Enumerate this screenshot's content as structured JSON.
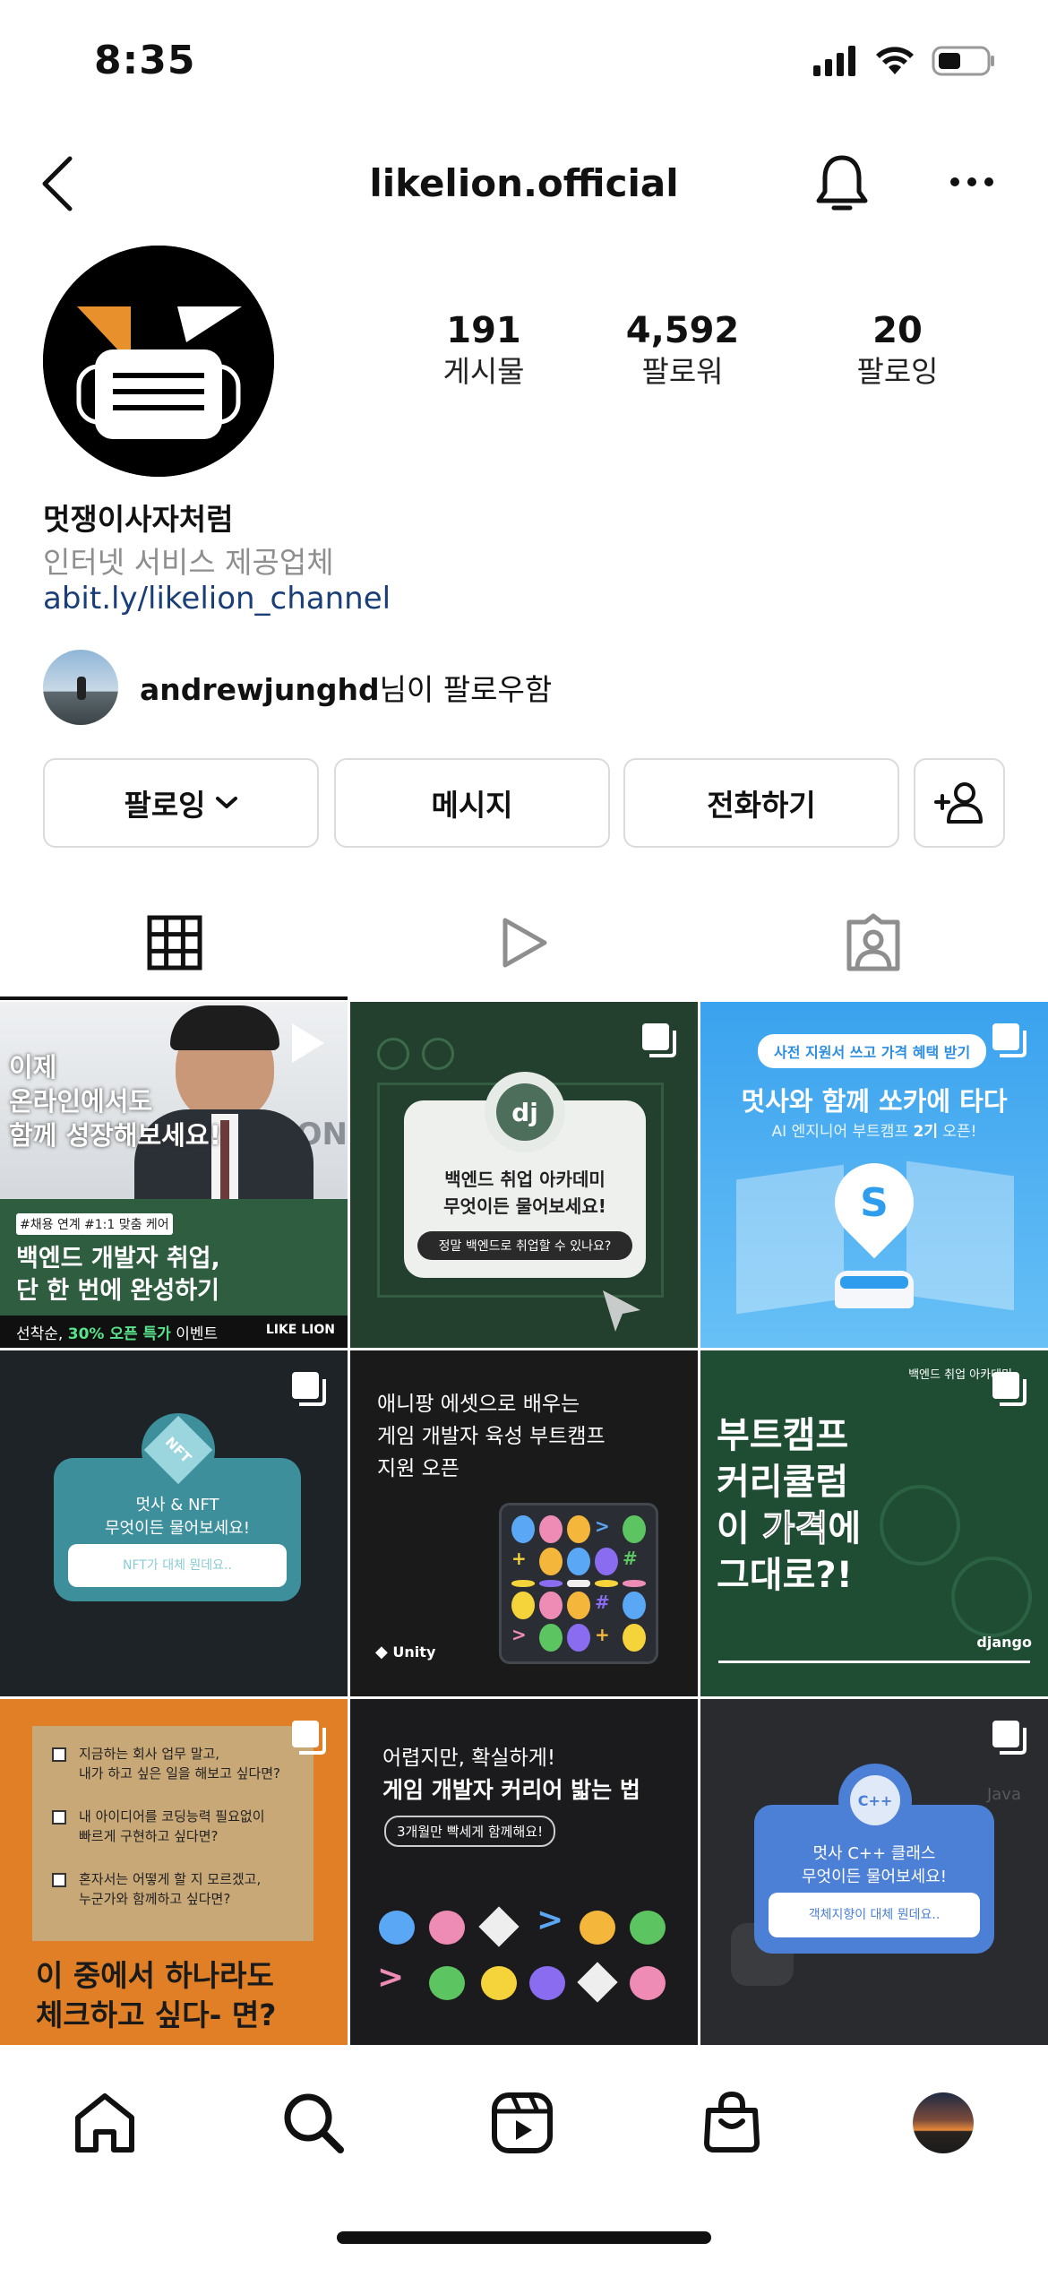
{
  "status_bar": {
    "time": "8:35"
  },
  "header": {
    "username": "likelion.official"
  },
  "profile": {
    "display_name": "멋쟁이사자처럼",
    "category": "인터넷 서비스 제공업체",
    "link": "abit.ly/likelion_channel",
    "stats": [
      {
        "number": "191",
        "label": "게시물"
      },
      {
        "number": "4,592",
        "label": "팔로워"
      },
      {
        "number": "20",
        "label": "팔로잉"
      }
    ],
    "followed_by": {
      "user": "andrewjunghd",
      "suffix": "님이 팔로우함"
    }
  },
  "actions": {
    "following_label": "팔로잉",
    "message_label": "메시지",
    "call_label": "전화하기"
  },
  "posts": {
    "p1": {
      "l1": "이제",
      "l2": "온라인에서도",
      "l3": "함께 성장해보세요!",
      "tag1": "#채용 연계",
      "tag2": "#1:1 맞춤 케어",
      "t1": "백엔드 개발자 취업,",
      "t2": "단 한 번에 완성하기",
      "footer_a": "선착순, ",
      "footer_b": "30% 오픈 특가",
      "footer_c": " 이벤트",
      "brand": "LIKE LION",
      "bg_logo": "ION"
    },
    "p2": {
      "badge": "dj",
      "t1": "백엔드 취업 아카데미",
      "t2": "무엇이든 물어보세요!",
      "q": "정말 백엔드로 취업할 수 있나요?"
    },
    "p3": {
      "pill": "사전 지원서 쓰고 가격 혜택 받기",
      "title": "멋사와 함께 쏘카에 타다",
      "sub_a": "AI 엔지니어 부트캠프 ",
      "sub_b": "2기",
      "sub_c": " 오픈!",
      "pin": "S"
    },
    "p4": {
      "badge": "NFT",
      "t1": "멋사 & NFT",
      "t2": "무엇이든 물어보세요!",
      "placeholder": "NFT가 대체 뭔데요.."
    },
    "p5": {
      "t1": "애니팡 에셋으로 배우는",
      "t2": "게임 개발자 육성 부트캠프",
      "t3": "지원 오픈",
      "brand": "Unity"
    },
    "p6": {
      "corner": "백엔드 취업 아카데미",
      "l1": "부트캠프",
      "l2": "커리큘럼",
      "l3a": "이 ",
      "l3b": "가격",
      "l3c": "에",
      "l4": "그대로?!",
      "brand": "django"
    },
    "p7": {
      "c1a": "지금하는 회사 업무 말고,",
      "c1b": "내가 하고 싶은 일을 해보고 싶다면?",
      "c2a": "내 아이디어를 코딩능력 필요없이",
      "c2b": "빠르게 구현하고 싶다면?",
      "c3a": "혼자서는 어떻게 할 지 모르겠고,",
      "c3b": "누군가와 함께하고 싶다면?",
      "t1": "이 중에서 하나라도",
      "t2": "체크하고 싶다- 면?"
    },
    "p8": {
      "t1": "어렵지만, 확실하게!",
      "t2": "게임 개발자 커리어 밟는 법",
      "pill": "3개월만 빡세게 함께해요!"
    },
    "p9": {
      "badge": "C++",
      "java": "Java",
      "t1": "멋사 C++ 클래스",
      "t2": "무엇이든 물어보세요!",
      "placeholder": "객체지향이 대체 뭔데요.."
    }
  },
  "colors": {
    "link": "#1a3e78",
    "grey_text": "#8e8e8e",
    "border": "#dbdbdb",
    "orange": "#e07f25",
    "green": "#2f6a45",
    "sky": "#4aaaf0"
  },
  "icons": [
    "back-icon",
    "bell-icon",
    "more-icon",
    "chevron-down-icon",
    "add-person-icon",
    "grid-icon",
    "reels-tab-icon",
    "tagged-icon",
    "home-icon",
    "search-icon",
    "reels-icon",
    "shop-icon",
    "multi-post-icon"
  ]
}
